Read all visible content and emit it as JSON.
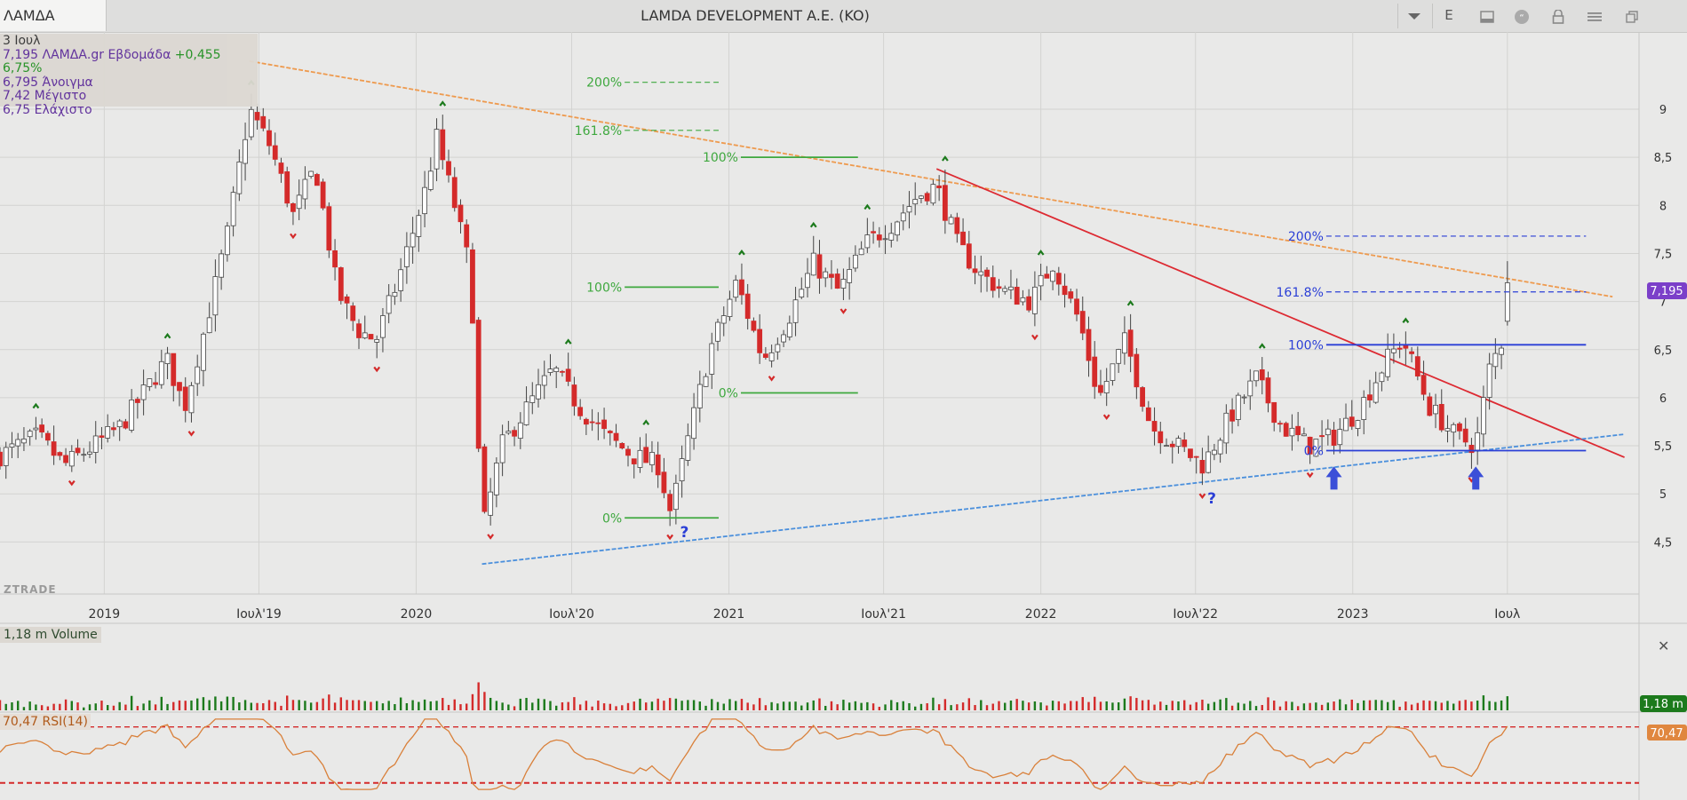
{
  "toolbar": {
    "symbol": "ΛΑΜΔΑ",
    "title": "LAMDA DEVELOPMENT A.E. (KO)",
    "e_label": "E",
    "icons": [
      "chevron-down-icon",
      "panel-icon",
      "comment-icon",
      "lock-icon",
      "menu-icon",
      "restore-window-icon"
    ]
  },
  "info": {
    "date": "3 Ιουλ",
    "line1_main": "7,195 ΛΑΜΔΑ.gr Εβδομάδα",
    "line1_change": "+0,455 6,75%",
    "open": "6,795 Άνοιγμα",
    "high": "7,42 Μέγιστο",
    "low": "6,75 Ελάχιστο"
  },
  "brand": "ZTRADE",
  "volume_label": "1,18 m Volume",
  "volume_badge": "1,18 m",
  "rsi_label": "70,47 RSI(14)",
  "rsi_badge": "70,47",
  "price_badge": "7,195",
  "colors": {
    "up": "#1c7a1c",
    "down": "#d42a2a",
    "green_fib": "#3ea83e",
    "blue_fib": "#2b3fd6",
    "orange_line": "#ee9a4e",
    "red_line": "#dd2a32",
    "blue_trend": "#4a8fdc",
    "rsi_line": "#d9803a",
    "price_badge": "#7b3fc9"
  },
  "chart_data": {
    "type": "candlestick",
    "timeframe": "weekly",
    "ylim": [
      4.1,
      9.6
    ],
    "y_ticks": [
      "9",
      "8,5",
      "8",
      "7,5",
      "7",
      "6,5",
      "6",
      "5,5",
      "5",
      "4,5"
    ],
    "y_tick_values": [
      9,
      8.5,
      8,
      7.5,
      7,
      6.5,
      6,
      5.5,
      5,
      4.5
    ],
    "x_ticks": [
      "2019",
      "Ιουλ'19",
      "2020",
      "Ιουλ'20",
      "2021",
      "Ιουλ'21",
      "2022",
      "Ιουλ'22",
      "2023",
      "Ιουλ"
    ],
    "x_tick_dates": [
      "2019-01-01",
      "2019-07-01",
      "2020-01-01",
      "2020-07-01",
      "2021-01-01",
      "2021-07-01",
      "2022-01-01",
      "2022-07-01",
      "2023-01-01",
      "2023-07-01"
    ],
    "price_path": [
      [
        "2018-09-01",
        5.4
      ],
      [
        "2018-10-15",
        5.6
      ],
      [
        "2018-11-15",
        5.3
      ],
      [
        "2018-12-20",
        5.5
      ],
      [
        "2019-01-20",
        5.7
      ],
      [
        "2019-02-20",
        6.1
      ],
      [
        "2019-03-15",
        6.4
      ],
      [
        "2019-04-05",
        5.9
      ],
      [
        "2019-05-01",
        6.8
      ],
      [
        "2019-05-25",
        7.7
      ],
      [
        "2019-06-20",
        9.0
      ],
      [
        "2019-07-15",
        8.6
      ],
      [
        "2019-08-10",
        7.9
      ],
      [
        "2019-09-05",
        8.4
      ],
      [
        "2019-10-01",
        7.1
      ],
      [
        "2019-10-25",
        6.7
      ],
      [
        "2019-11-15",
        6.6
      ],
      [
        "2019-12-10",
        7.2
      ],
      [
        "2020-01-10",
        8.1
      ],
      [
        "2020-01-25",
        8.7
      ],
      [
        "2020-02-15",
        8.0
      ],
      [
        "2020-03-05",
        7.3
      ],
      [
        "2020-03-18",
        4.6
      ],
      [
        "2020-04-10",
        5.5
      ],
      [
        "2020-05-10",
        5.9
      ],
      [
        "2020-06-10",
        6.3
      ],
      [
        "2020-07-10",
        5.9
      ],
      [
        "2020-08-10",
        5.6
      ],
      [
        "2020-09-10",
        5.4
      ],
      [
        "2020-10-10",
        5.3
      ],
      [
        "2020-10-25",
        4.8
      ],
      [
        "2020-11-15",
        5.6
      ],
      [
        "2020-12-10",
        6.5
      ],
      [
        "2021-01-10",
        7.2
      ],
      [
        "2021-02-10",
        6.4
      ],
      [
        "2021-03-10",
        6.8
      ],
      [
        "2021-04-10",
        7.4
      ],
      [
        "2021-05-10",
        7.1
      ],
      [
        "2021-06-10",
        7.6
      ],
      [
        "2021-07-10",
        7.8
      ],
      [
        "2021-08-10",
        8.1
      ],
      [
        "2021-09-01",
        8.2
      ],
      [
        "2021-09-25",
        7.6
      ],
      [
        "2021-10-20",
        7.3
      ],
      [
        "2021-11-20",
        7.1
      ],
      [
        "2021-12-20",
        7.0
      ],
      [
        "2022-01-15",
        7.4
      ],
      [
        "2022-02-15",
        6.8
      ],
      [
        "2022-03-10",
        6.0
      ],
      [
        "2022-04-10",
        6.6
      ],
      [
        "2022-05-10",
        5.7
      ],
      [
        "2022-06-10",
        5.5
      ],
      [
        "2022-07-10",
        5.3
      ],
      [
        "2022-08-10",
        5.8
      ],
      [
        "2022-09-10",
        6.2
      ],
      [
        "2022-10-10",
        5.7
      ],
      [
        "2022-11-10",
        5.5
      ],
      [
        "2022-12-10",
        5.6
      ],
      [
        "2023-01-10",
        5.9
      ],
      [
        "2023-02-10",
        6.4
      ],
      [
        "2023-03-01",
        6.6
      ],
      [
        "2023-04-01",
        5.9
      ],
      [
        "2023-05-01",
        5.6
      ],
      [
        "2023-05-25",
        5.5
      ],
      [
        "2023-06-10",
        6.3
      ],
      [
        "2023-06-25",
        6.6
      ],
      [
        "2023-07-03",
        7.195
      ]
    ],
    "last_bar": {
      "date": "2023-07-03",
      "open": 6.795,
      "high": 7.42,
      "low": 6.75,
      "close": 7.195,
      "change": 0.455,
      "change_pct": 6.75
    },
    "trendlines": [
      {
        "name": "resistance",
        "color": "#ee9a4e",
        "from": [
          "2019-06-20",
          9.5
        ],
        "to": [
          "2023-11-01",
          7.05
        ]
      },
      {
        "name": "falling",
        "color": "#dd2a32",
        "from": [
          "2021-09-01",
          8.38
        ],
        "to": [
          "2023-11-15",
          5.38
        ]
      },
      {
        "name": "support",
        "color": "#4a8fdc",
        "from": [
          "2020-03-18",
          4.27
        ],
        "to": [
          "2023-11-15",
          5.62
        ]
      }
    ],
    "fib_levels": [
      {
        "set": "green",
        "label": "200%",
        "value": 9.28,
        "from": "2020-09-01",
        "to": "2020-12-20"
      },
      {
        "set": "green",
        "label": "161.8%",
        "value": 8.78,
        "from": "2020-09-01",
        "to": "2020-12-20"
      },
      {
        "set": "green",
        "label": "100%",
        "value": 8.5,
        "from": "2021-01-15",
        "to": "2021-06-01"
      },
      {
        "set": "green",
        "label": "100%",
        "value": 7.15,
        "from": "2020-09-01",
        "to": "2020-12-20"
      },
      {
        "set": "green",
        "label": "0%",
        "value": 6.05,
        "from": "2021-01-15",
        "to": "2021-06-01"
      },
      {
        "set": "green",
        "label": "0%",
        "value": 4.75,
        "from": "2020-09-01",
        "to": "2020-12-20"
      },
      {
        "set": "blue",
        "label": "200%",
        "value": 7.68,
        "from": "2022-12-01",
        "to": "2023-10-01"
      },
      {
        "set": "blue",
        "label": "161.8%",
        "value": 7.1,
        "from": "2022-12-01",
        "to": "2023-10-01"
      },
      {
        "set": "blue",
        "label": "100%",
        "value": 6.55,
        "from": "2022-12-01",
        "to": "2023-10-01"
      },
      {
        "set": "blue",
        "label": "0%",
        "value": 5.45,
        "from": "2022-12-01",
        "to": "2023-10-01"
      }
    ],
    "annotations": [
      {
        "type": "question",
        "text": "?",
        "date": "2020-11-10",
        "value": 4.55
      },
      {
        "type": "question",
        "text": "?",
        "date": "2022-07-20",
        "value": 4.9
      },
      {
        "type": "arrow-up",
        "date": "2022-12-10",
        "value": 5.1
      },
      {
        "type": "arrow-up",
        "date": "2023-05-25",
        "value": 5.1
      }
    ],
    "volume": {
      "last_value": "1,18 m"
    },
    "rsi": {
      "period": 14,
      "last_value": 70.47,
      "upper": 70,
      "lower": 30
    }
  }
}
